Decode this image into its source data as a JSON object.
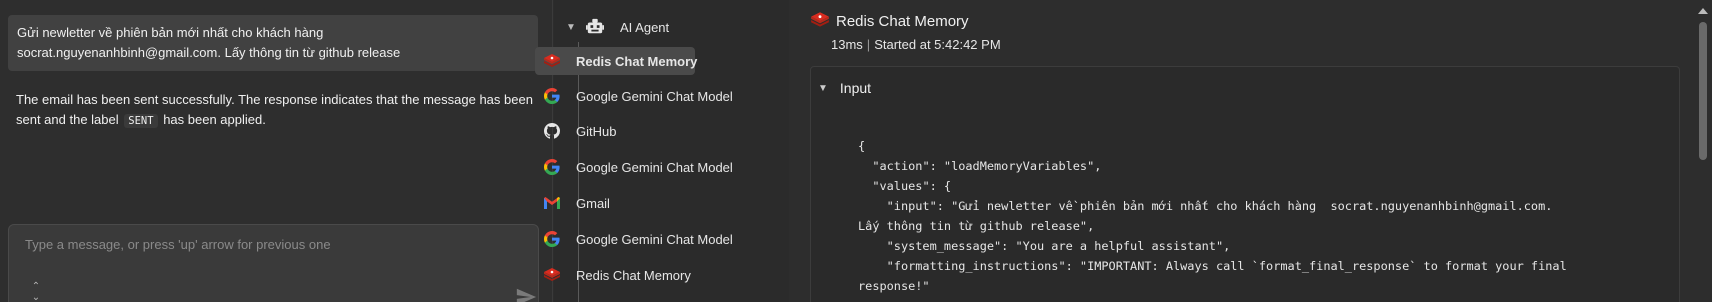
{
  "chat": {
    "user_message_line1": "Gửi newletter về phiên bản mới nhất cho khách hàng",
    "user_message_line2": "socrat.nguyenanhbinh@gmail.com. Lấy thông tin từ github release",
    "bot_message_part1": "The email has been sent successfully. The response indicates that the message has been sent and the label",
    "bot_message_code": "SENT",
    "bot_message_part2": "has been applied.",
    "input_placeholder": "Type a message, or press 'up' arrow for previous one"
  },
  "tree": {
    "root_label": "AI Agent",
    "items": [
      {
        "label": "Redis Chat Memory",
        "icon": "redis-icon",
        "active": true
      },
      {
        "label": "Google Gemini Chat Model",
        "icon": "google-icon",
        "active": false
      },
      {
        "label": "GitHub",
        "icon": "github-icon",
        "active": false
      },
      {
        "label": "Google Gemini Chat Model",
        "icon": "google-icon",
        "active": false
      },
      {
        "label": "Gmail",
        "icon": "gmail-icon",
        "active": false
      },
      {
        "label": "Google Gemini Chat Model",
        "icon": "google-icon",
        "active": false
      },
      {
        "label": "Redis Chat Memory",
        "icon": "redis-icon",
        "active": false
      }
    ]
  },
  "detail": {
    "title": "Redis Chat Memory",
    "duration": "13ms",
    "started": "Started at 5:42:42 PM",
    "section_label": "Input",
    "json_text": "{\n  \"action\": \"loadMemoryVariables\",\n  \"values\": {\n    \"input\": \"Gửi newletter về phiên bản mới nhất cho khách hàng  socrat.nguyenanhbinh@gmail.com.\nLấy thông tin từ github release\",\n    \"system_message\": \"You are a helpful assistant\",\n    \"formatting_instructions\": \"IMPORTANT: Always call `format_final_response` to format your final\nresponse!\""
  },
  "colors": {
    "redis": "#d82c20",
    "gmail_red": "#ea4335",
    "google_blue": "#4285f4",
    "google_green": "#34a853",
    "google_yellow": "#fbbc05"
  }
}
